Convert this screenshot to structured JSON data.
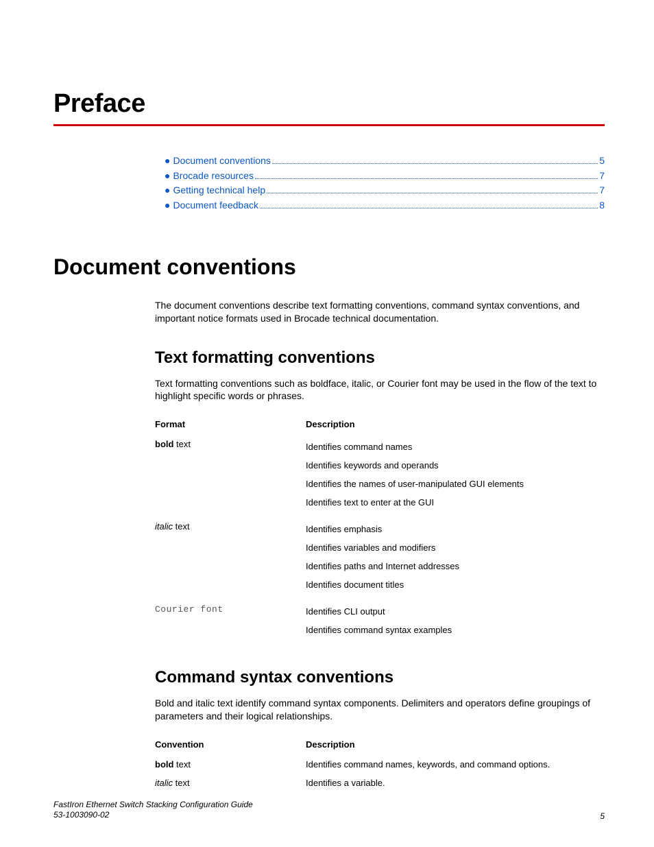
{
  "chapter": {
    "title": "Preface"
  },
  "toc": {
    "items": [
      {
        "label": "Document conventions",
        "page": "5"
      },
      {
        "label": "Brocade resources",
        "page": "7"
      },
      {
        "label": "Getting technical help",
        "page": "7"
      },
      {
        "label": "Document feedback",
        "page": "8"
      }
    ]
  },
  "section": {
    "title": "Document conventions",
    "intro": "The document conventions describe text formatting conventions, command syntax conventions, and important notice formats used in Brocade technical documentation."
  },
  "text_formatting": {
    "title": "Text formatting conventions",
    "intro": "Text formatting conventions such as boldface, italic, or Courier font may be used in the flow of the text to highlight specific words or phrases.",
    "headers": {
      "col1": "Format",
      "col2": "Description"
    },
    "rows": [
      {
        "format_prefix": "bold",
        "format_suffix": " text",
        "style": "bold",
        "desc": [
          "Identifies command names",
          "Identifies keywords and operands",
          "Identifies the names of user-manipulated GUI elements",
          "Identifies text to enter at the GUI"
        ]
      },
      {
        "format_prefix": "italic",
        "format_suffix": " text",
        "style": "italic",
        "desc": [
          "Identifies emphasis",
          "Identifies variables and modifiers",
          "Identifies paths and Internet addresses",
          "Identifies document titles"
        ]
      },
      {
        "format_prefix": "Courier font",
        "format_suffix": "",
        "style": "courier",
        "desc": [
          "Identifies CLI output",
          "Identifies command syntax examples"
        ]
      }
    ]
  },
  "command_syntax": {
    "title": "Command syntax conventions",
    "intro": "Bold and italic text identify command syntax components. Delimiters and operators define groupings of parameters and their logical relationships.",
    "headers": {
      "col1": "Convention",
      "col2": "Description"
    },
    "rows": [
      {
        "format_prefix": "bold",
        "format_suffix": " text",
        "style": "bold",
        "desc": "Identifies command names, keywords, and command options."
      },
      {
        "format_prefix": "italic",
        "format_suffix": " text",
        "style": "italic",
        "desc": "Identifies a variable."
      }
    ]
  },
  "footer": {
    "guide": "FastIron Ethernet Switch Stacking Configuration Guide",
    "docnum": "53-1003090-02",
    "pagenum": "5"
  }
}
